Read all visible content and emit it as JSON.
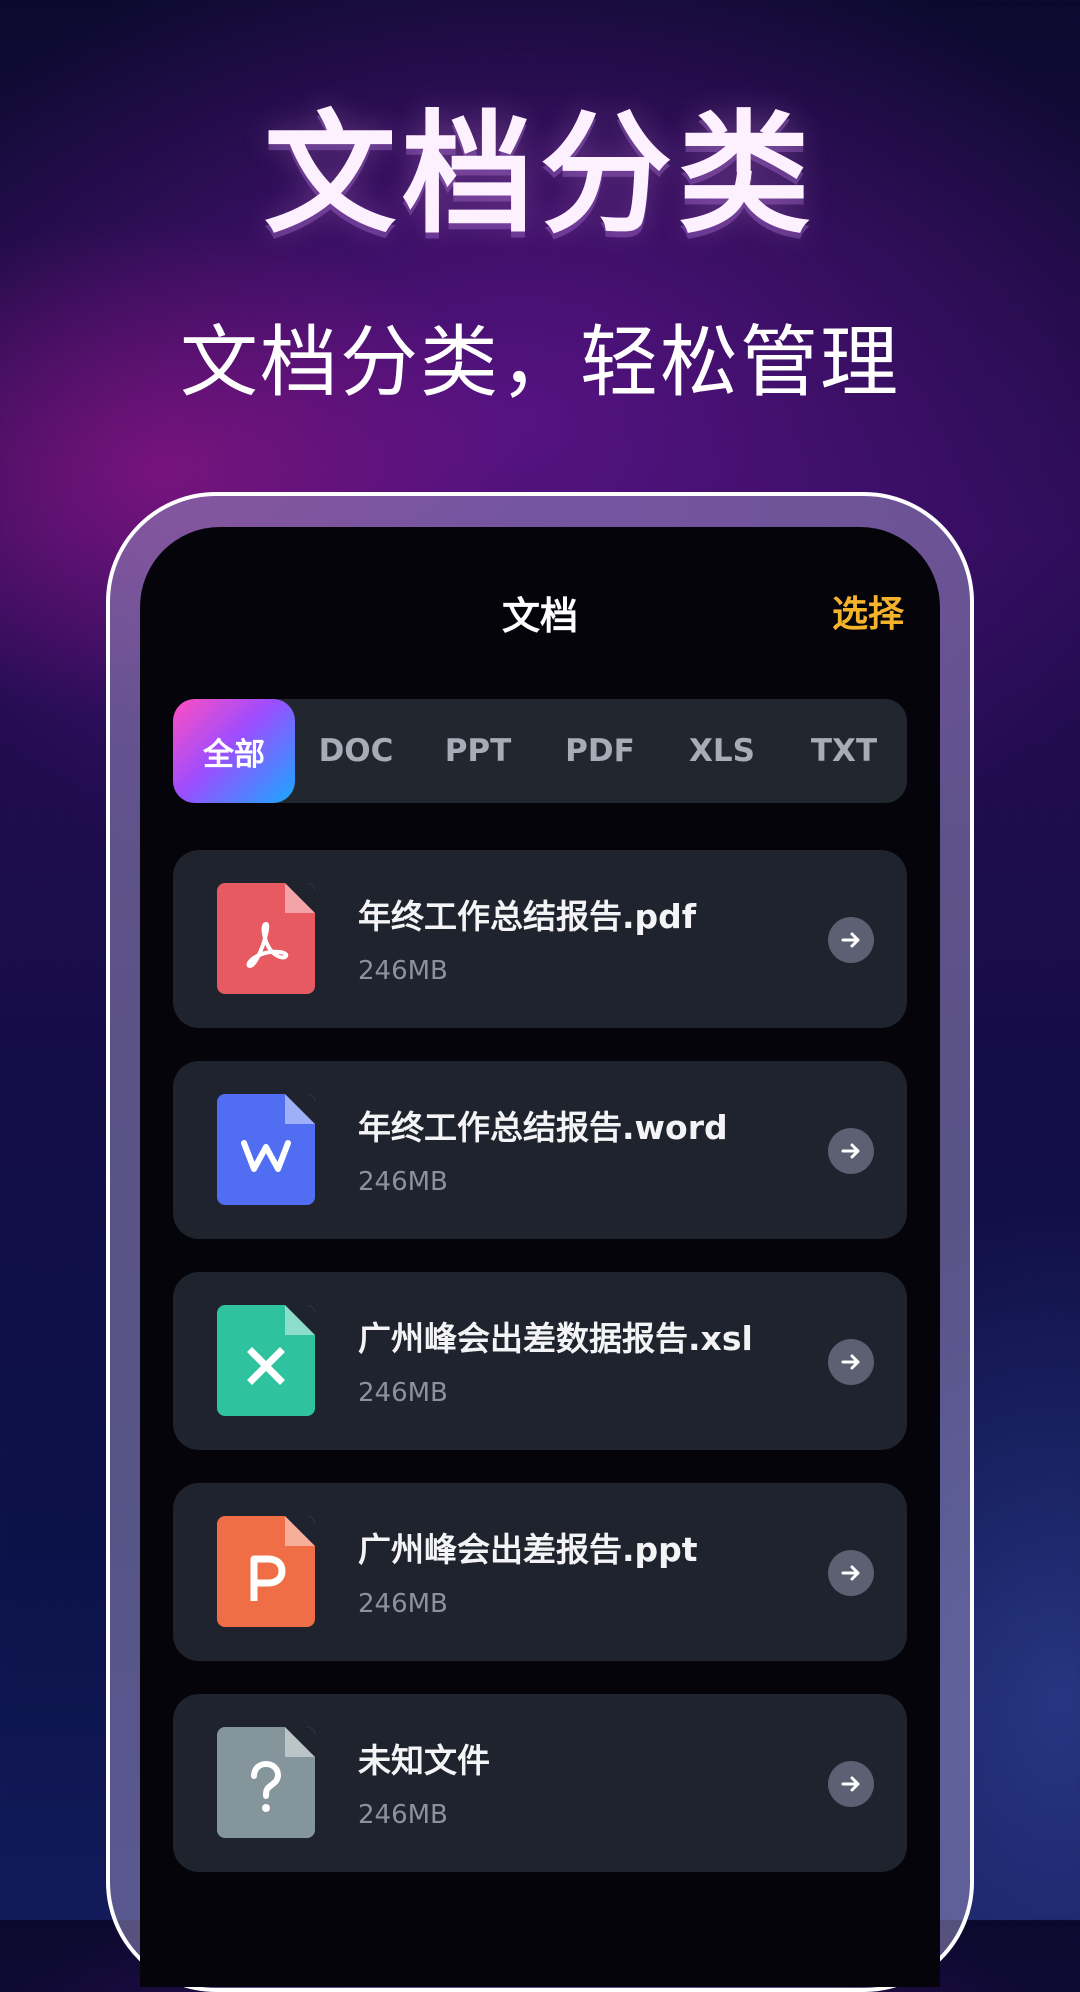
{
  "hero": {
    "title": "文档分类",
    "subtitle": "文档分类，轻松管理"
  },
  "screen": {
    "nav_title": "文档",
    "select_label": "选择",
    "tabs": [
      {
        "label": "全部",
        "active": true
      },
      {
        "label": "DOC",
        "active": false
      },
      {
        "label": "PPT",
        "active": false
      },
      {
        "label": "PDF",
        "active": false
      },
      {
        "label": "XLS",
        "active": false
      },
      {
        "label": "TXT",
        "active": false
      }
    ],
    "files": [
      {
        "name": "年终工作总结报告.pdf",
        "size": "246MB",
        "icon": "pdf-icon",
        "color": "#e85a62"
      },
      {
        "name": "年终工作总结报告.word",
        "size": "246MB",
        "icon": "word-icon",
        "color": "#516ef2"
      },
      {
        "name": "广州峰会出差数据报告.xsl",
        "size": "246MB",
        "icon": "excel-icon",
        "color": "#2ec39e"
      },
      {
        "name": "广州峰会出差报告.ppt",
        "size": "246MB",
        "icon": "ppt-icon",
        "color": "#f06e45"
      },
      {
        "name": "未知文件",
        "size": "246MB",
        "icon": "unknown-file-icon",
        "color": "#84969c"
      }
    ]
  },
  "colors": {
    "accent": "#f5b32b",
    "card": "#1f232d",
    "screen": "#04040a"
  }
}
